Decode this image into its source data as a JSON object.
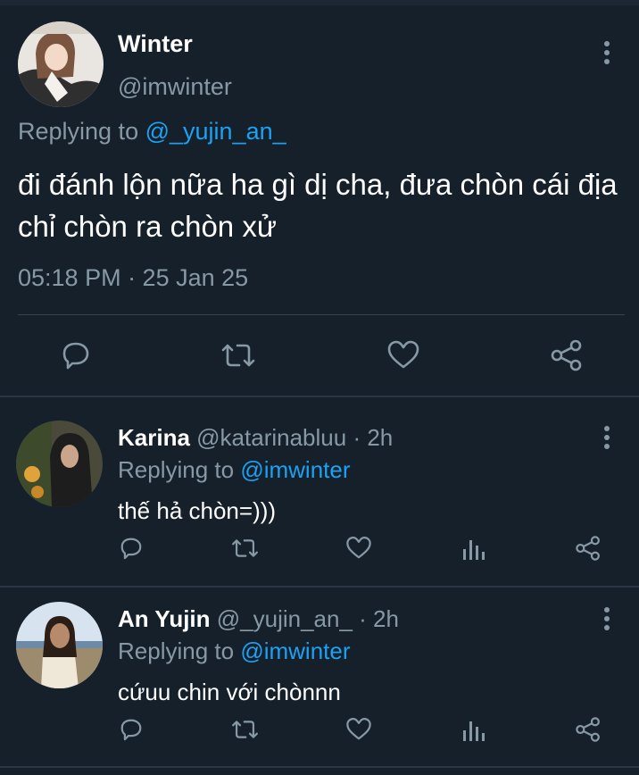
{
  "tweet": {
    "name": "Winter",
    "handle": "@imwinter",
    "replying_prefix": "Replying to ",
    "replying_handle": "@_yujin_an_",
    "text": "đi đánh lộn nữa ha gì dị cha, đưa chòn cái địa chỉ chòn ra chòn xử",
    "timestamp": "05:18 PM · 25 Jan 25",
    "actions": [
      "reply-icon",
      "retweet-icon",
      "like-icon",
      "share-icon"
    ]
  },
  "replies": [
    {
      "name": "Karina",
      "handle": "@katarinabluu",
      "age": " · 2h",
      "replying_prefix": "Replying to ",
      "replying_handle": "@imwinter",
      "text": "thế hả chòn=)))"
    },
    {
      "name": "An Yujin",
      "handle": "@_yujin_an_",
      "age": " · 2h",
      "replying_prefix": "Replying to ",
      "replying_handle": "@imwinter",
      "text": "cứuu chin với chònnn"
    }
  ],
  "colors": {
    "background": "#15202b",
    "secondary_text": "#8899a6",
    "link": "#1da1f2",
    "divider": "#38444d"
  }
}
